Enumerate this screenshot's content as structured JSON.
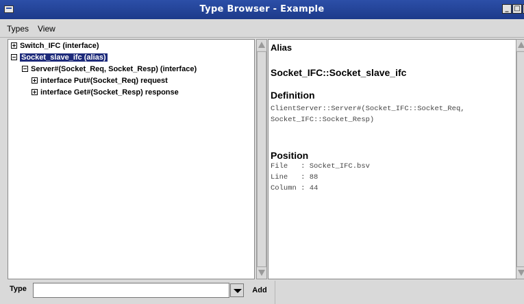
{
  "window": {
    "title": "Type Browser - Example"
  },
  "menu": {
    "types": "Types",
    "view": "View"
  },
  "tree": {
    "rows": [
      {
        "label": "Switch_IFC (interface)",
        "expander": "plus"
      },
      {
        "label": "Socket_slave_ifc (alias)",
        "expander": "minus",
        "selected": true
      },
      {
        "label": "Server#(Socket_Req, Socket_Resp) (interface)",
        "expander": "minus"
      },
      {
        "label": "interface Put#(Socket_Req) request",
        "expander": "plus"
      },
      {
        "label": "interface Get#(Socket_Resp) response",
        "expander": "plus"
      }
    ]
  },
  "details": {
    "alias_heading": "Alias",
    "alias_name": "Socket_IFC::Socket_slave_ifc",
    "definition_heading": "Definition",
    "definition_line1": "ClientServer::Server#(Socket_IFC::Socket_Req,",
    "definition_line2": "Socket_IFC::Socket_Resp)",
    "position_heading": "Position",
    "file_line": "File   : Socket_IFC.bsv",
    "line_line": "Line   : 88",
    "column_line": "Column : 44"
  },
  "bottom": {
    "type_label": "Type",
    "type_value": "",
    "add_label": "Add"
  },
  "colors": {
    "titlebar": "#2c4fa8",
    "selection": "#1d2a7a",
    "background": "#d9d9d9"
  }
}
